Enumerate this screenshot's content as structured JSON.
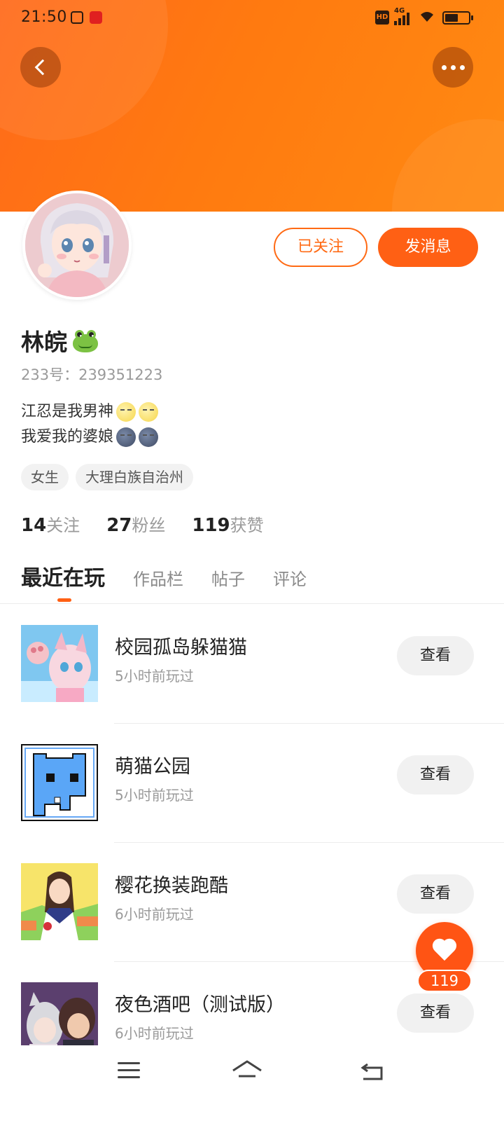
{
  "status_bar": {
    "time": "21:50",
    "network": "4G",
    "hd": "HD"
  },
  "header": {
    "back_icon": "chevron-left-icon",
    "more_icon": "more-dots-icon"
  },
  "profile": {
    "name": "林皖",
    "name_emoji": "frog-emoji",
    "uid": "233号：239351223",
    "bio_lines": [
      "江忍是我男神",
      "我爱我的婆娘"
    ],
    "tags": [
      "女生",
      "大理白族自治州"
    ],
    "stats": [
      {
        "num": "14",
        "label": "关注"
      },
      {
        "num": "27",
        "label": "粉丝"
      },
      {
        "num": "119",
        "label": "获赞"
      }
    ],
    "followed_label": "已关注",
    "message_label": "发消息"
  },
  "tabs": [
    "最近在玩",
    "作品栏",
    "帖子",
    "评论"
  ],
  "games": [
    {
      "title": "校园孤岛躲猫猫",
      "time": "5小时前玩过",
      "action": "查看"
    },
    {
      "title": "萌猫公园",
      "time": "5小时前玩过",
      "action": "查看"
    },
    {
      "title": "樱花换装跑酷",
      "time": "6小时前玩过",
      "action": "查看"
    },
    {
      "title": "夜色酒吧（测试版）",
      "time": "6小时前玩过",
      "action": "查看"
    }
  ],
  "like": {
    "count": "119"
  },
  "colors": {
    "accent": "#ff6014",
    "header": "#ff7a10",
    "muted": "#9a9a9a"
  }
}
